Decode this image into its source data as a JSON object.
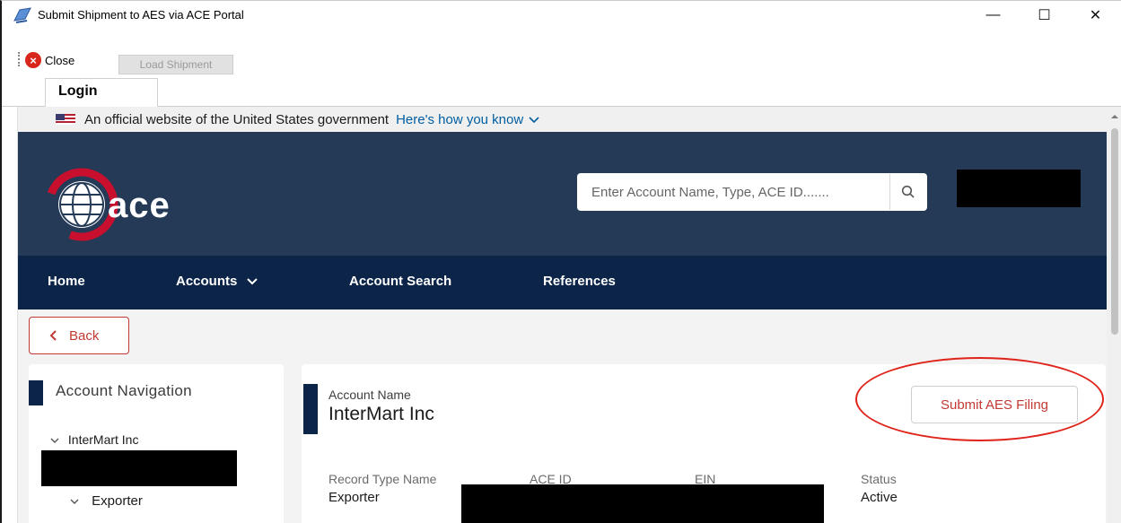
{
  "window": {
    "title": "Submit Shipment to AES via ACE Portal",
    "minimize": "—",
    "maximize": "☐",
    "close": "✕"
  },
  "toolbar": {
    "close_label": "Close",
    "load_label": "Load Shipment"
  },
  "tabs": {
    "login": "Login"
  },
  "gov_banner": {
    "text": "An official website of the United States government",
    "how_link": "Here's how you know"
  },
  "header": {
    "logo_text": "ace",
    "search_placeholder": "Enter Account Name, Type, ACE ID......."
  },
  "nav": {
    "items": [
      "Home",
      "Accounts",
      "Account Search",
      "References"
    ]
  },
  "back_label": "Back",
  "account_nav": {
    "title": "Account Navigation",
    "items": [
      "InterMart Inc",
      "Exporter"
    ]
  },
  "account": {
    "name_label": "Account Name",
    "name": "InterMart Inc",
    "submit_label": "Submit AES Filing",
    "fields": {
      "record_type_label": "Record Type Name",
      "record_type_value": "Exporter",
      "ace_id_label": "ACE ID",
      "ein_label": "EIN",
      "status_label": "Status",
      "status_value": "Active"
    }
  },
  "colors": {
    "header_bg": "#243a57",
    "nav_bg": "#0b2448",
    "accent_red": "#c23934",
    "highlight_circle": "#e0231a"
  }
}
